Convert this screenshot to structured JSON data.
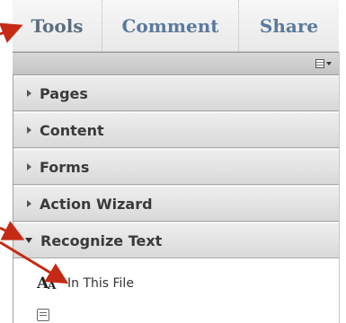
{
  "tabs": [
    {
      "label": "Tools"
    },
    {
      "label": "Comment"
    },
    {
      "label": "Share"
    }
  ],
  "sections": [
    {
      "label": "Pages",
      "expanded": false
    },
    {
      "label": "Content",
      "expanded": false
    },
    {
      "label": "Forms",
      "expanded": false
    },
    {
      "label": "Action Wizard",
      "expanded": false
    },
    {
      "label": "Recognize Text",
      "expanded": true
    }
  ],
  "tools": [
    {
      "label": "In This File",
      "icon": "text-recognition-icon"
    }
  ],
  "colors": {
    "annotation_arrow": "#c62a14",
    "tab_text": "#5b7a9c"
  }
}
